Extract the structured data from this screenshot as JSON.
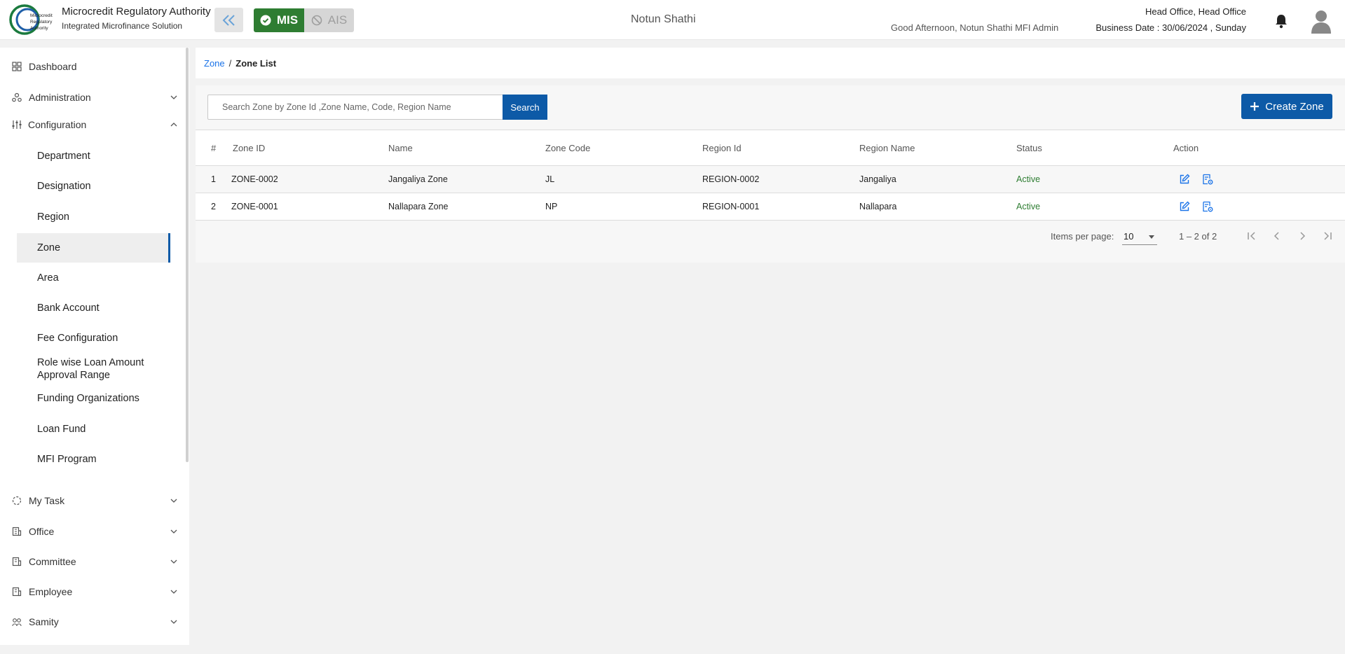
{
  "header": {
    "brand_title": "Microcredit Regulatory Authority",
    "brand_subtitle": "Integrated Microfinance Solution",
    "logo_text": "Microcredit Regulatory Authority",
    "mis_label": "MIS",
    "ais_label": "AIS",
    "organization": "Notun Shathi",
    "greeting": "Good Afternoon, Notun Shathi MFI Admin",
    "office": "Head Office, Head Office",
    "business_date": "Business Date : 30/06/2024 , Sunday",
    "colors": {
      "mis": "#2e7d32",
      "ais": "#d6d6d6",
      "primary": "#0d5aa7"
    }
  },
  "sidebar": {
    "items": [
      {
        "label": "Dashboard",
        "icon": "dashboard-icon"
      },
      {
        "label": "Administration",
        "icon": "administration-icon"
      },
      {
        "label": "Configuration",
        "icon": "configuration-icon"
      }
    ],
    "config_sub": [
      {
        "label": "Department"
      },
      {
        "label": "Designation"
      },
      {
        "label": "Region"
      },
      {
        "label": "Zone"
      },
      {
        "label": "Area"
      },
      {
        "label": "Bank Account"
      },
      {
        "label": "Fee Configuration"
      },
      {
        "label": "Role wise Loan Amount Approval Range"
      },
      {
        "label": "Funding Organizations"
      },
      {
        "label": "Loan Fund"
      },
      {
        "label": "MFI Program"
      }
    ],
    "bottom_items": [
      {
        "label": "My Task",
        "icon": "task-icon"
      },
      {
        "label": "Office",
        "icon": "office-icon"
      },
      {
        "label": "Committee",
        "icon": "committee-icon"
      },
      {
        "label": "Employee",
        "icon": "employee-icon"
      },
      {
        "label": "Samity",
        "icon": "samity-icon"
      }
    ]
  },
  "breadcrumb": {
    "parent": "Zone",
    "separator": "/",
    "current": "Zone List"
  },
  "toolbar": {
    "search_placeholder": "Search Zone by Zone Id ,Zone Name, Code, Region Name",
    "search_label": "Search",
    "create_label": "Create Zone"
  },
  "table": {
    "headers": [
      "#",
      "Zone ID",
      "Name",
      "Zone Code",
      "Region Id",
      "Region Name",
      "Status",
      "Action"
    ],
    "rows": [
      {
        "num": "1",
        "zone_id": "ZONE-0002",
        "name": "Jangaliya Zone",
        "code": "JL",
        "region_id": "REGION-0002",
        "region_name": "Jangaliya",
        "status": "Active"
      },
      {
        "num": "2",
        "zone_id": "ZONE-0001",
        "name": "Nallapara Zone",
        "code": "NP",
        "region_id": "REGION-0001",
        "region_name": "Nallapara",
        "status": "Active"
      }
    ]
  },
  "paginator": {
    "items_per_page_label": "Items per page:",
    "page_size": "10",
    "range": "1 – 2 of 2"
  }
}
